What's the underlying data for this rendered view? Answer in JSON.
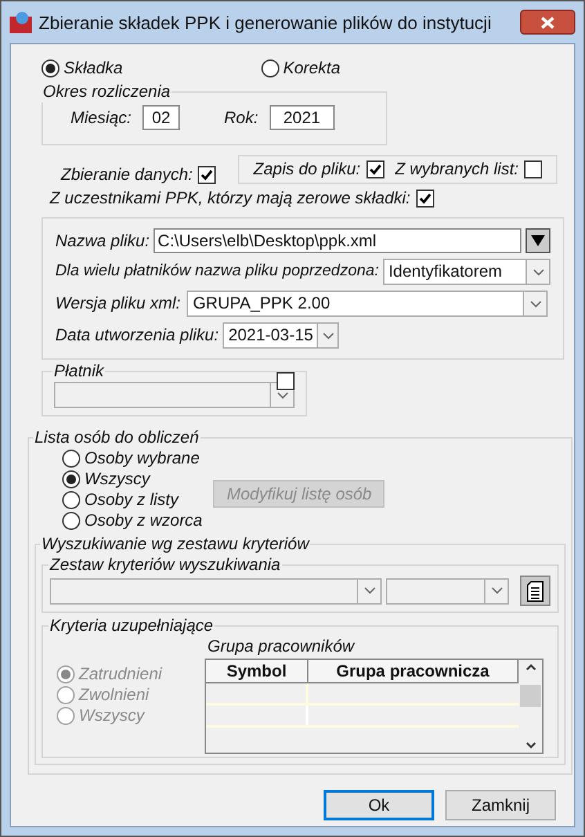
{
  "window": {
    "title": "Zbieranie składek PPK i generowanie plików do instytucji"
  },
  "mode_options": [
    {
      "label": "Składka",
      "selected": true
    },
    {
      "label": "Korekta",
      "selected": false
    }
  ],
  "period": {
    "title": "Okres rozliczenia",
    "month_label": "Miesiąc:",
    "month": "02",
    "year_label": "Rok:",
    "year": "2021"
  },
  "collect_data": {
    "label": "Zbieranie danych:",
    "checked": true
  },
  "save_options": [
    {
      "label": "Zapis do pliku:",
      "checked": true
    },
    {
      "label": "Z wybranych list:",
      "checked": false
    }
  ],
  "zero_contributions": {
    "label": "Z uczestnikami PPK, którzy mają zerowe składki:",
    "checked": true
  },
  "file": {
    "name_label": "Nazwa pliku:",
    "name": "C:\\Users\\elb\\Desktop\\ppk.xml",
    "prefix_label": "Dla wielu płatników nazwa pliku poprzedzona:",
    "prefix": "Identyfikatorem",
    "version_label": "Wersja pliku xml:",
    "version": "GRUPA_PPK 2.00",
    "date_label": "Data utworzenia pliku:",
    "date": "2021-03-15"
  },
  "payer": {
    "title": "Płatnik",
    "checked": false
  },
  "people": {
    "title": "Lista osób do obliczeń",
    "options": [
      {
        "label": "Osoby wybrane",
        "selected": false
      },
      {
        "label": "Wszyscy",
        "selected": true
      },
      {
        "label": "Osoby z listy",
        "selected": false
      },
      {
        "label": "Osoby z wzorca",
        "selected": false
      }
    ],
    "modify_button": {
      "label": "Modyfikuj listę osób",
      "disabled": true
    }
  },
  "search": {
    "title": "Wyszukiwanie wg zestawu kryteriów",
    "set_title": "Zestaw kryteriów wyszukiwania"
  },
  "extra": {
    "title": "Kryteria uzupełniające",
    "options": [
      {
        "label": "Zatrudnieni",
        "selected": true,
        "disabled": true
      },
      {
        "label": "Zwolnieni",
        "selected": false,
        "disabled": true
      },
      {
        "label": "Wszyscy",
        "selected": false,
        "disabled": true
      }
    ],
    "group_title": "Grupa pracowników",
    "columns": [
      "Symbol",
      "Grupa pracownicza"
    ]
  },
  "buttons": [
    {
      "label": "Ok",
      "focused": true
    },
    {
      "label": "Zamknij",
      "focused": false
    }
  ]
}
